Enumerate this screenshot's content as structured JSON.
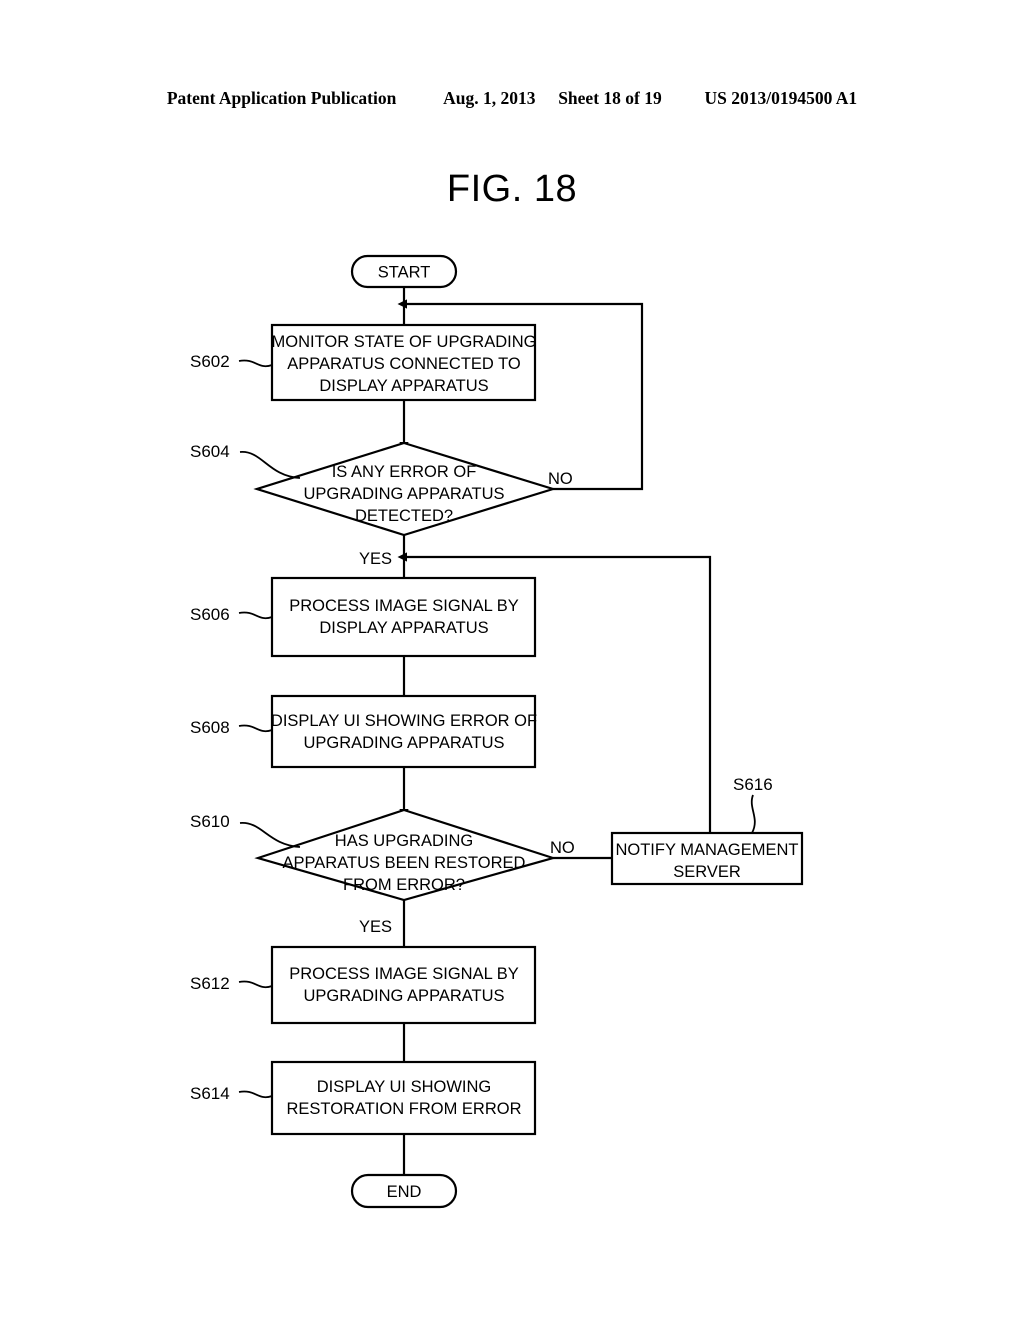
{
  "header": {
    "publication": "Patent Application Publication",
    "date": "Aug. 1, 2013",
    "sheet": "Sheet 18 of 19",
    "patent_number": "US 2013/0194500 A1"
  },
  "figure": {
    "title": "FIG. 18"
  },
  "flowchart": {
    "terminals": {
      "start": "START",
      "end": "END"
    },
    "nodes": [
      {
        "id": "S602",
        "step": "S602",
        "type": "process",
        "lines": [
          "MONITOR STATE OF UPGRADING",
          "APPARATUS CONNECTED TO",
          "DISPLAY APPARATUS"
        ]
      },
      {
        "id": "S604",
        "step": "S604",
        "type": "decision",
        "lines": [
          "IS ANY ERROR OF",
          "UPGRADING APPARATUS",
          "DETECTED?"
        ]
      },
      {
        "id": "S606",
        "step": "S606",
        "type": "process",
        "lines": [
          "PROCESS IMAGE SIGNAL BY",
          "DISPLAY APPARATUS"
        ]
      },
      {
        "id": "S608",
        "step": "S608",
        "type": "process",
        "lines": [
          "DISPLAY UI SHOWING ERROR OF",
          "UPGRADING APPARATUS"
        ]
      },
      {
        "id": "S610",
        "step": "S610",
        "type": "decision",
        "lines": [
          "HAS UPGRADING",
          "APPARATUS BEEN RESTORED",
          "FROM ERROR?"
        ]
      },
      {
        "id": "S616",
        "step": "S616",
        "type": "process",
        "lines": [
          "NOTIFY MANAGEMENT",
          "SERVER"
        ]
      },
      {
        "id": "S612",
        "step": "S612",
        "type": "process",
        "lines": [
          "PROCESS IMAGE SIGNAL BY",
          "UPGRADING APPARATUS"
        ]
      },
      {
        "id": "S614",
        "step": "S614",
        "type": "process",
        "lines": [
          "DISPLAY UI SHOWING",
          "RESTORATION FROM ERROR"
        ]
      }
    ],
    "branch_labels": {
      "s604_no": "NO",
      "s604_yes": "YES",
      "s610_no": "NO",
      "s610_yes": "YES"
    }
  },
  "colors": {
    "ink": "#000000",
    "paper": "#ffffff"
  }
}
